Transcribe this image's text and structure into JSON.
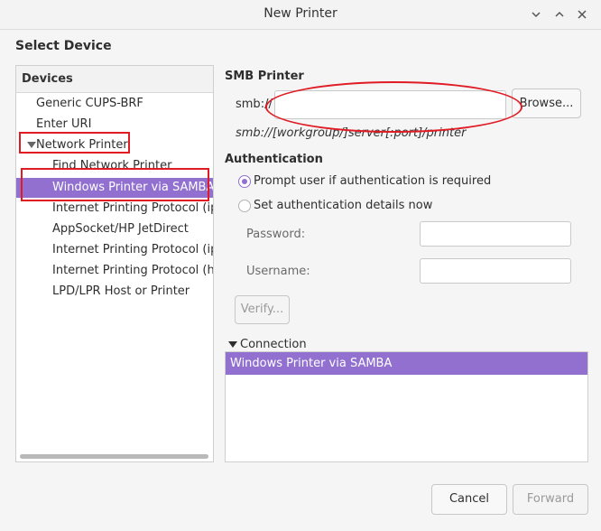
{
  "window": {
    "title": "New Printer"
  },
  "page": {
    "heading": "Select Device"
  },
  "devices": {
    "header": "Devices",
    "items": [
      {
        "label": "Generic CUPS-BRF"
      },
      {
        "label": "Enter URI"
      },
      {
        "label": "Network Printer"
      },
      {
        "label": "Find Network Printer"
      },
      {
        "label": "Windows Printer via SAMBA"
      },
      {
        "label": "Internet Printing Protocol (ipp)"
      },
      {
        "label": "AppSocket/HP JetDirect"
      },
      {
        "label": "Internet Printing Protocol (ipps)"
      },
      {
        "label": "Internet Printing Protocol (https)"
      },
      {
        "label": "LPD/LPR Host or Printer"
      }
    ],
    "selected": "Windows Printer via SAMBA"
  },
  "smb": {
    "heading": "SMB Printer",
    "prefix": "smb://",
    "value": "",
    "browse_label": "Browse...",
    "hint": "smb://[workgroup/]server[:port]/printer"
  },
  "auth": {
    "heading": "Authentication",
    "option_prompt": "Prompt user if authentication is required",
    "option_set": "Set authentication details now",
    "selected_option": "prompt",
    "password_label": "Password:",
    "password_value": "",
    "username_label": "Username:",
    "username_value": "",
    "verify_label": "Verify..."
  },
  "connection": {
    "label": "Connection",
    "items": [
      {
        "label": "Windows Printer via SAMBA"
      }
    ]
  },
  "footer": {
    "cancel_label": "Cancel",
    "forward_label": "Forward"
  },
  "colors": {
    "selection": "#9170d0",
    "annotation": "#e01b24"
  }
}
